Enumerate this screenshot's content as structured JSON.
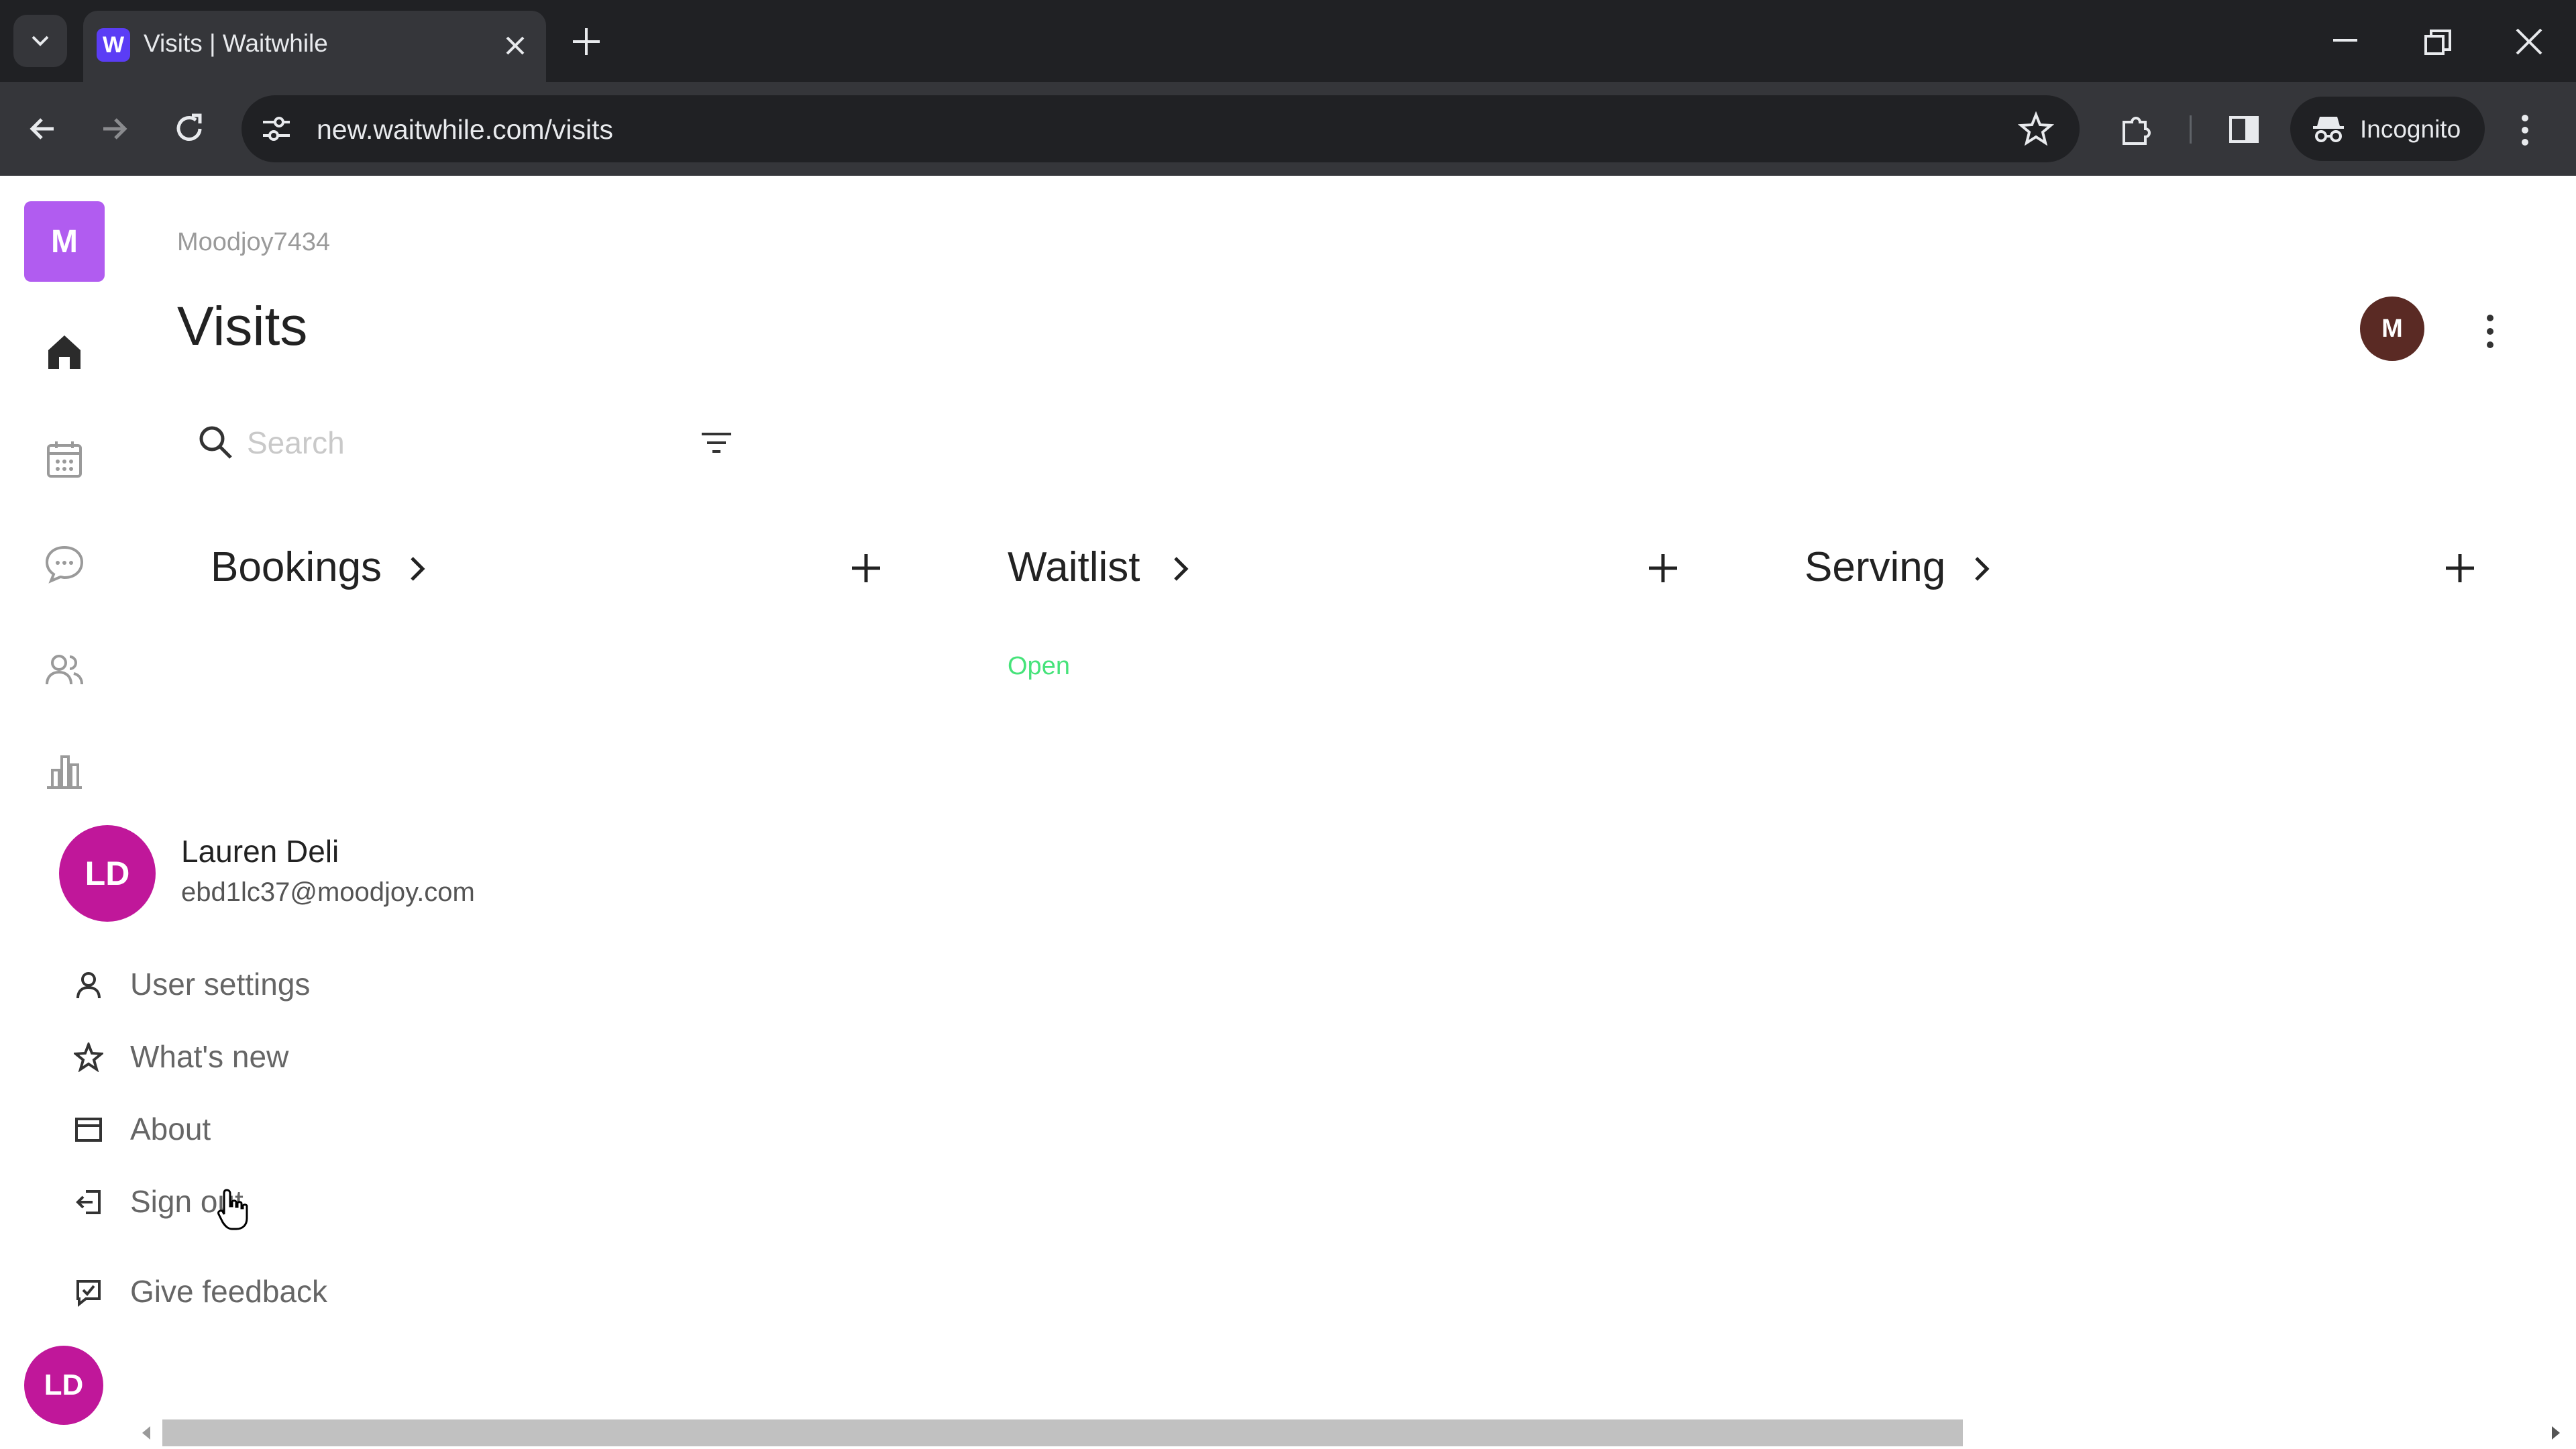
{
  "browser": {
    "tab_title": "Visits | Waitwhile",
    "favicon_letter": "W",
    "url": "new.waitwhile.com/visits",
    "incognito_label": "Incognito"
  },
  "app": {
    "org_initial": "M",
    "account_name": "Moodjoy7434",
    "page_title": "Visits",
    "top_avatar_initial": "M",
    "search": {
      "placeholder": "Search",
      "value": ""
    },
    "rail_icons": [
      "home-icon",
      "calendar-icon",
      "chat-icon",
      "customers-icon",
      "analytics-icon"
    ],
    "columns": [
      {
        "title": "Bookings"
      },
      {
        "title": "Waitlist",
        "status": "Open"
      },
      {
        "title": "Serving"
      }
    ],
    "status_color": "#46e37a"
  },
  "user_menu": {
    "avatar_initials": "LD",
    "name": "Lauren Deli",
    "email": "ebd1lc37@moodjoy.com",
    "items": [
      {
        "label": "User settings",
        "icon": "user-icon"
      },
      {
        "label": "What's new",
        "icon": "star-icon"
      },
      {
        "label": "About",
        "icon": "window-icon"
      },
      {
        "label": "Sign out",
        "icon": "sign-out-icon"
      },
      {
        "label": "Give feedback",
        "icon": "feedback-icon"
      }
    ]
  },
  "footer": {
    "avatar_initials": "LD"
  },
  "colors": {
    "brand_purple": "#b15cf0",
    "user_avatar": "#c0179a",
    "account_avatar": "#5a2a24"
  }
}
